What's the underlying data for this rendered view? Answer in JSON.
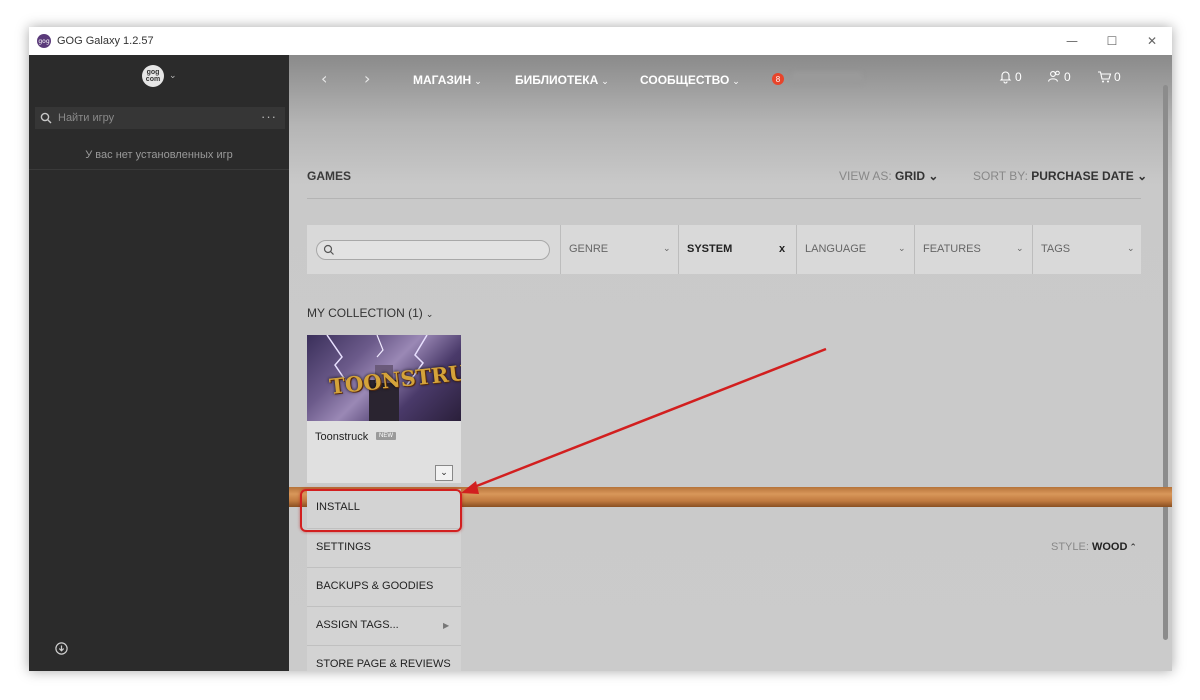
{
  "window": {
    "title": "GOG Galaxy 1.2.57",
    "controls": [
      "—",
      "☐",
      "✕"
    ]
  },
  "sidebar": {
    "logo_text": "gog com",
    "search_placeholder": "Найти игру",
    "more_label": "···",
    "empty_text": "У вас нет установленных игр"
  },
  "topnav": {
    "back_icon": "‹",
    "forward_icon": "›",
    "items": [
      {
        "label": "МАГАЗИН",
        "chev": "⌄"
      },
      {
        "label": "БИБЛИОТЕКА",
        "chev": "⌄"
      },
      {
        "label": "СООБЩЕСТВО",
        "chev": "⌄"
      }
    ],
    "notifications_count": "0",
    "friends_count": "0",
    "cart_count": "0"
  },
  "library": {
    "title": "GAMES",
    "view_as_label": "VIEW AS:",
    "view_as_value": "GRID",
    "sort_by_label": "SORT BY:",
    "sort_by_value": "PURCHASE DATE",
    "filters": {
      "genre": "GENRE",
      "system": "SYSTEM",
      "system_clear": "x",
      "language": "LANGUAGE",
      "features": "FEATURES",
      "tags": "TAGS"
    },
    "collection_label": "MY COLLECTION (1)",
    "game": {
      "name": "Toonstruck",
      "badge": "NEW",
      "cover_text": "TOONSTRUCK"
    },
    "context_menu": [
      {
        "label": "INSTALL"
      },
      {
        "label": "SETTINGS"
      },
      {
        "label": "BACKUPS & GOODIES"
      },
      {
        "label": "ASSIGN TAGS..."
      },
      {
        "label": "STORE PAGE & REVIEWS"
      }
    ],
    "style_label": "STYLE:",
    "style_value": "WOOD"
  },
  "colors": {
    "sidebar_bg": "#2b2b2b",
    "accent_red": "#d21f1f",
    "shelf_wood": "#c07a3f"
  }
}
